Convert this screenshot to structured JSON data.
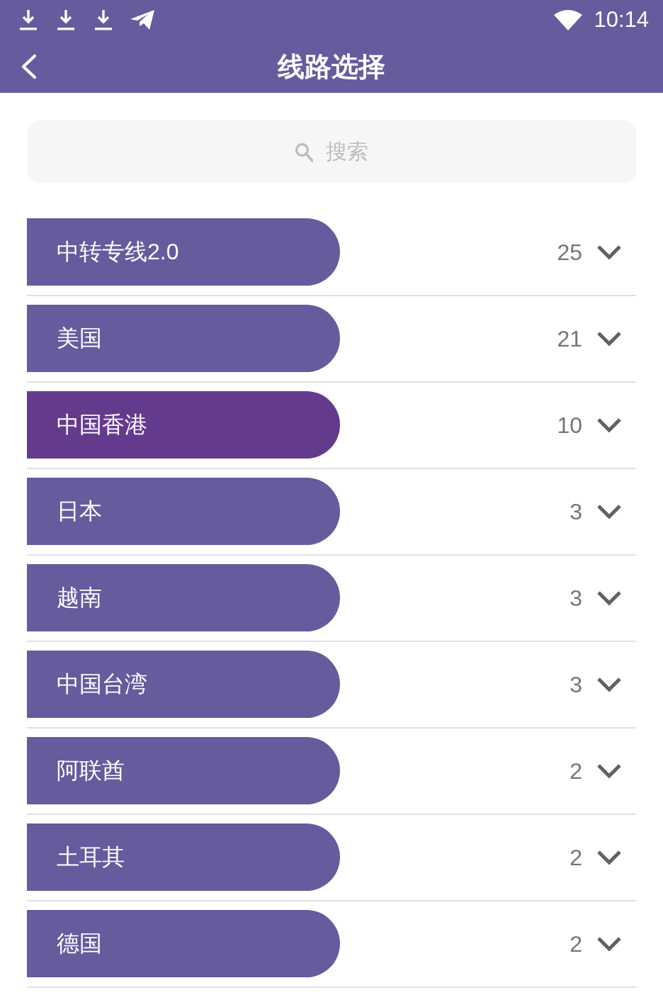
{
  "status_bar": {
    "time": "10:14"
  },
  "header": {
    "title": "线路选择"
  },
  "search": {
    "placeholder": "搜索"
  },
  "groups": [
    {
      "name": "中转专线2.0",
      "count": "25",
      "selected": false,
      "expanded": false
    },
    {
      "name": "美国",
      "count": "21",
      "selected": false,
      "expanded": false
    },
    {
      "name": "中国香港",
      "count": "10",
      "selected": true,
      "expanded": false
    },
    {
      "name": "日本",
      "count": "3",
      "selected": false,
      "expanded": false
    },
    {
      "name": "越南",
      "count": "3",
      "selected": false,
      "expanded": false
    },
    {
      "name": "中国台湾",
      "count": "3",
      "selected": false,
      "expanded": false
    },
    {
      "name": "阿联酋",
      "count": "2",
      "selected": false,
      "expanded": false
    },
    {
      "name": "土耳其",
      "count": "2",
      "selected": false,
      "expanded": false
    },
    {
      "name": "德国",
      "count": "2",
      "selected": false,
      "expanded": false
    }
  ]
}
